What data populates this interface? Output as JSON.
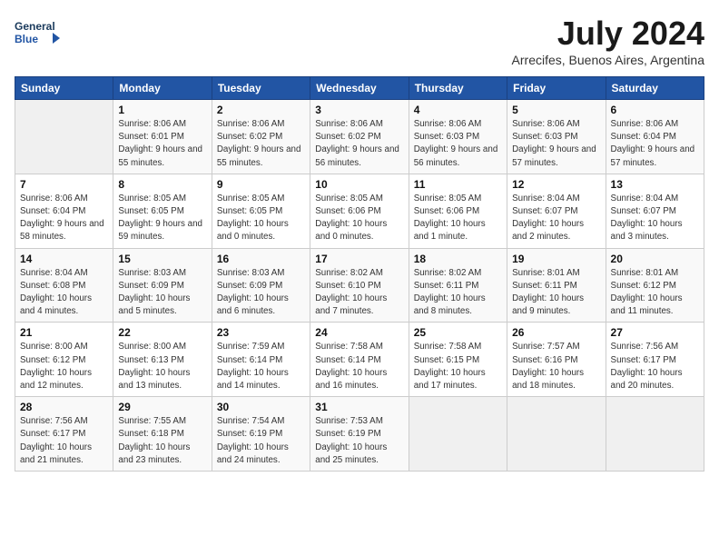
{
  "header": {
    "logo_line1": "General",
    "logo_line2": "Blue",
    "month_year": "July 2024",
    "location": "Arrecifes, Buenos Aires, Argentina"
  },
  "weekdays": [
    "Sunday",
    "Monday",
    "Tuesday",
    "Wednesday",
    "Thursday",
    "Friday",
    "Saturday"
  ],
  "weeks": [
    [
      {
        "day": "",
        "empty": true
      },
      {
        "day": "1",
        "rise": "8:06 AM",
        "set": "6:01 PM",
        "daylight": "9 hours and 55 minutes."
      },
      {
        "day": "2",
        "rise": "8:06 AM",
        "set": "6:02 PM",
        "daylight": "9 hours and 55 minutes."
      },
      {
        "day": "3",
        "rise": "8:06 AM",
        "set": "6:02 PM",
        "daylight": "9 hours and 56 minutes."
      },
      {
        "day": "4",
        "rise": "8:06 AM",
        "set": "6:03 PM",
        "daylight": "9 hours and 56 minutes."
      },
      {
        "day": "5",
        "rise": "8:06 AM",
        "set": "6:03 PM",
        "daylight": "9 hours and 57 minutes."
      },
      {
        "day": "6",
        "rise": "8:06 AM",
        "set": "6:04 PM",
        "daylight": "9 hours and 57 minutes."
      }
    ],
    [
      {
        "day": "7",
        "rise": "8:06 AM",
        "set": "6:04 PM",
        "daylight": "9 hours and 58 minutes."
      },
      {
        "day": "8",
        "rise": "8:05 AM",
        "set": "6:05 PM",
        "daylight": "9 hours and 59 minutes."
      },
      {
        "day": "9",
        "rise": "8:05 AM",
        "set": "6:05 PM",
        "daylight": "10 hours and 0 minutes."
      },
      {
        "day": "10",
        "rise": "8:05 AM",
        "set": "6:06 PM",
        "daylight": "10 hours and 0 minutes."
      },
      {
        "day": "11",
        "rise": "8:05 AM",
        "set": "6:06 PM",
        "daylight": "10 hours and 1 minute."
      },
      {
        "day": "12",
        "rise": "8:04 AM",
        "set": "6:07 PM",
        "daylight": "10 hours and 2 minutes."
      },
      {
        "day": "13",
        "rise": "8:04 AM",
        "set": "6:07 PM",
        "daylight": "10 hours and 3 minutes."
      }
    ],
    [
      {
        "day": "14",
        "rise": "8:04 AM",
        "set": "6:08 PM",
        "daylight": "10 hours and 4 minutes."
      },
      {
        "day": "15",
        "rise": "8:03 AM",
        "set": "6:09 PM",
        "daylight": "10 hours and 5 minutes."
      },
      {
        "day": "16",
        "rise": "8:03 AM",
        "set": "6:09 PM",
        "daylight": "10 hours and 6 minutes."
      },
      {
        "day": "17",
        "rise": "8:02 AM",
        "set": "6:10 PM",
        "daylight": "10 hours and 7 minutes."
      },
      {
        "day": "18",
        "rise": "8:02 AM",
        "set": "6:11 PM",
        "daylight": "10 hours and 8 minutes."
      },
      {
        "day": "19",
        "rise": "8:01 AM",
        "set": "6:11 PM",
        "daylight": "10 hours and 9 minutes."
      },
      {
        "day": "20",
        "rise": "8:01 AM",
        "set": "6:12 PM",
        "daylight": "10 hours and 11 minutes."
      }
    ],
    [
      {
        "day": "21",
        "rise": "8:00 AM",
        "set": "6:12 PM",
        "daylight": "10 hours and 12 minutes."
      },
      {
        "day": "22",
        "rise": "8:00 AM",
        "set": "6:13 PM",
        "daylight": "10 hours and 13 minutes."
      },
      {
        "day": "23",
        "rise": "7:59 AM",
        "set": "6:14 PM",
        "daylight": "10 hours and 14 minutes."
      },
      {
        "day": "24",
        "rise": "7:58 AM",
        "set": "6:14 PM",
        "daylight": "10 hours and 16 minutes."
      },
      {
        "day": "25",
        "rise": "7:58 AM",
        "set": "6:15 PM",
        "daylight": "10 hours and 17 minutes."
      },
      {
        "day": "26",
        "rise": "7:57 AM",
        "set": "6:16 PM",
        "daylight": "10 hours and 18 minutes."
      },
      {
        "day": "27",
        "rise": "7:56 AM",
        "set": "6:17 PM",
        "daylight": "10 hours and 20 minutes."
      }
    ],
    [
      {
        "day": "28",
        "rise": "7:56 AM",
        "set": "6:17 PM",
        "daylight": "10 hours and 21 minutes."
      },
      {
        "day": "29",
        "rise": "7:55 AM",
        "set": "6:18 PM",
        "daylight": "10 hours and 23 minutes."
      },
      {
        "day": "30",
        "rise": "7:54 AM",
        "set": "6:19 PM",
        "daylight": "10 hours and 24 minutes."
      },
      {
        "day": "31",
        "rise": "7:53 AM",
        "set": "6:19 PM",
        "daylight": "10 hours and 25 minutes."
      },
      {
        "day": "",
        "empty": true
      },
      {
        "day": "",
        "empty": true
      },
      {
        "day": "",
        "empty": true
      }
    ]
  ]
}
